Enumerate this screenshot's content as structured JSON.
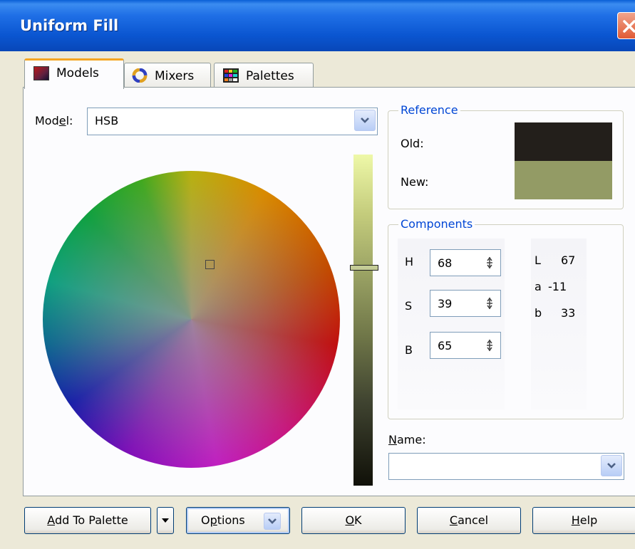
{
  "window": {
    "title": "Uniform Fill"
  },
  "tabs": [
    {
      "label": "Models",
      "icon": "models-icon"
    },
    {
      "label": "Mixers",
      "icon": "mixers-icon"
    },
    {
      "label": "Palettes",
      "icon": "palettes-icon"
    }
  ],
  "model": {
    "label_prefix": "Mod",
    "label_mnemonic": "e",
    "label_suffix": "l:",
    "value": "HSB"
  },
  "reference": {
    "title": "Reference",
    "old_label": "Old:",
    "new_label": "New:",
    "old_color": "#231f1b",
    "new_color": "#939b65"
  },
  "components": {
    "title": "Components",
    "fields": [
      {
        "label": "H",
        "value": "68"
      },
      {
        "label": "S",
        "value": "39"
      },
      {
        "label": "B",
        "value": "65"
      }
    ],
    "lab": [
      {
        "label": "L",
        "value": "67"
      },
      {
        "label": "a",
        "value": "-11"
      },
      {
        "label": "b",
        "value": "33"
      }
    ]
  },
  "name": {
    "label_mnemonic": "N",
    "label_rest": "ame:",
    "value": ""
  },
  "buttons": {
    "add_to_palette": {
      "mnemonic": "A",
      "rest": "dd To Palette"
    },
    "options": {
      "pre": "O",
      "mnemonic": "p",
      "rest": "tions"
    },
    "ok": {
      "mnemonic": "O",
      "rest": "K"
    },
    "cancel": {
      "mnemonic": "C",
      "rest": "ancel"
    },
    "help": {
      "mnemonic": "H",
      "rest": "elp"
    }
  },
  "brightness_level": 0.65
}
